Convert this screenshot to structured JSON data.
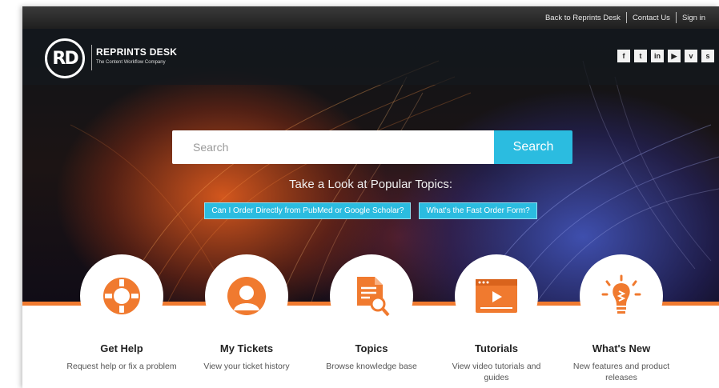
{
  "topbar": {
    "links": [
      "Back to Reprints Desk",
      "Contact Us",
      "Sign in"
    ]
  },
  "header": {
    "logo_mark": "RD",
    "brand_name": "REPRINTS DESK",
    "tagline": "The Content Workflow Company",
    "social_icons": [
      {
        "name": "facebook-icon",
        "glyph": "f"
      },
      {
        "name": "twitter-icon",
        "glyph": "t"
      },
      {
        "name": "linkedin-icon",
        "glyph": "in"
      },
      {
        "name": "youtube-icon",
        "glyph": "▶"
      },
      {
        "name": "vimeo-icon",
        "glyph": "v"
      },
      {
        "name": "slideshare-icon",
        "glyph": "s"
      }
    ]
  },
  "search": {
    "placeholder": "Search",
    "button_label": "Search"
  },
  "popular": {
    "heading": "Take a Look at Popular Topics:",
    "topics": [
      "Can I Order Directly from PubMed or Google Scholar?",
      "What's the Fast Order Form?"
    ]
  },
  "cards": [
    {
      "title": "Get Help",
      "desc": "Request help or fix a problem",
      "icon": "lifebuoy-icon"
    },
    {
      "title": "My Tickets",
      "desc": "View your ticket history",
      "icon": "user-icon"
    },
    {
      "title": "Topics",
      "desc": "Browse knowledge base",
      "icon": "document-search-icon"
    },
    {
      "title": "Tutorials",
      "desc": "View video tutorials and guides",
      "icon": "video-player-icon"
    },
    {
      "title": "What's New",
      "desc": "New features and product releases",
      "icon": "lightbulb-icon"
    }
  ],
  "colors": {
    "accent": "#2bbce0",
    "orange": "#f07a2f",
    "topbar": "#2a2a2a"
  }
}
